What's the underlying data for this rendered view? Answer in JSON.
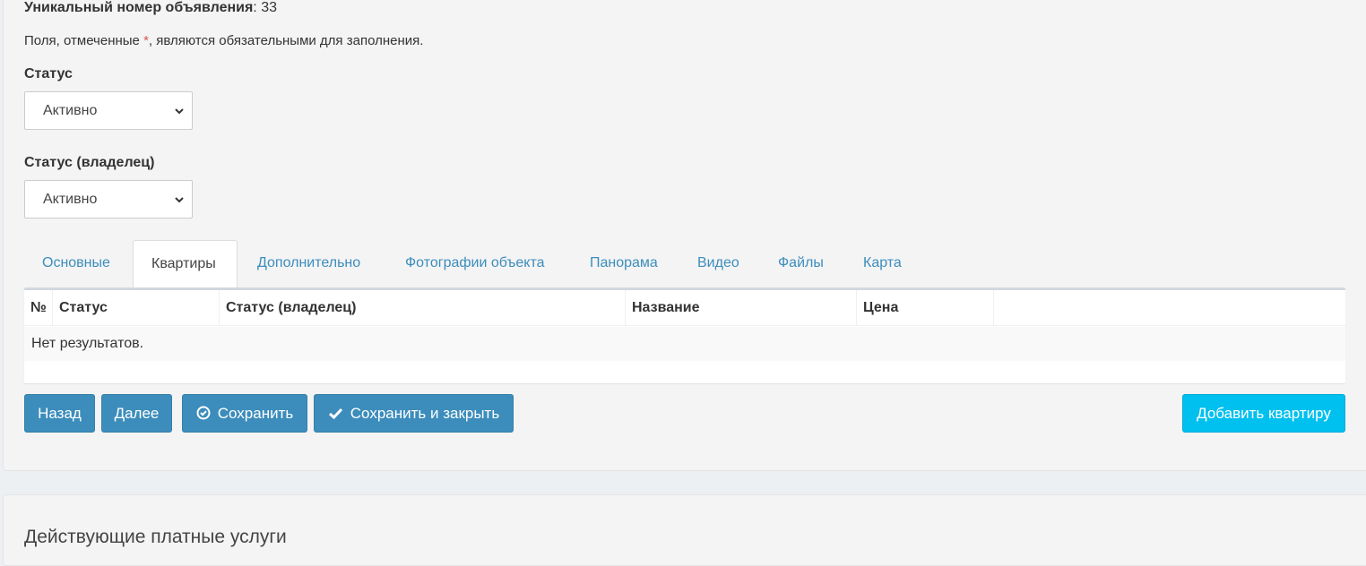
{
  "form": {
    "uid_label": "Уникальный номер объявления",
    "uid_value": ": 33",
    "required_note_pre": "Поля, отмеченные ",
    "required_star": "*",
    "required_note_post": ", являются обязательными для заполнения.",
    "status_label": "Статус",
    "status_value": "Активно",
    "owner_status_label": "Статус (владелец)",
    "owner_status_value": "Активно"
  },
  "tabs": [
    {
      "label": "Основные",
      "active": false
    },
    {
      "label": "Квартиры",
      "active": true
    },
    {
      "label": "Дополнительно",
      "active": false
    },
    {
      "label": "Фотографии объекта",
      "active": false
    },
    {
      "label": "Панорама",
      "active": false
    },
    {
      "label": "Видео",
      "active": false
    },
    {
      "label": "Файлы",
      "active": false
    },
    {
      "label": "Карта",
      "active": false
    }
  ],
  "table": {
    "headers": [
      "№",
      "Статус",
      "Статус (владелец)",
      "Название",
      "Цена",
      ""
    ],
    "empty_text": "Нет результатов."
  },
  "buttons": {
    "back": "Назад",
    "next": "Далее",
    "save": "Сохранить",
    "save_close": "Сохранить и закрыть",
    "add_apartment": "Добавить квартиру"
  },
  "services": {
    "title": "Действующие платные услуги"
  },
  "colors": {
    "primary": "#3c8dbc",
    "info": "#00c0ef",
    "required": "#d9534f"
  }
}
